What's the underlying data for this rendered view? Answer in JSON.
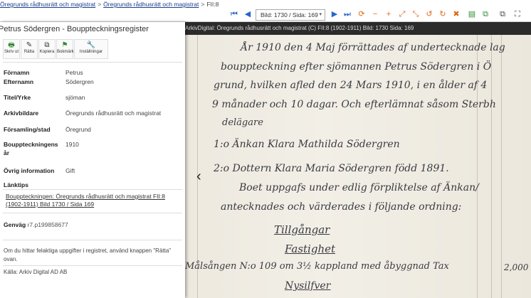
{
  "breadcrumb": {
    "items": [
      "Öregrunds rådhusrätt och magistrat",
      "Öregrunds rådhusrätt och magistrat",
      "FII:8"
    ],
    "separator": ">"
  },
  "toolbar": {
    "page_select": "Bild: 1730 / Sida: 169",
    "caret": "▾"
  },
  "icons": {
    "first": "⏮",
    "prev": "◀",
    "next": "▶",
    "last": "⏭",
    "refresh": "⟳",
    "zoom_out": "−",
    "zoom_in": "+",
    "fit": "⤢",
    "fit_width": "⤡",
    "rotate_left": "↺",
    "rotate_right": "↻",
    "close": "✖",
    "print": "▤",
    "copy": "⧉",
    "expand": "⛶"
  },
  "panel": {
    "title": "Petrus Södergren - Bouppteckningsregister",
    "actions": [
      {
        "icon": "🖶",
        "label": "Skriv ut"
      },
      {
        "icon": "✎",
        "label": "Rätta"
      },
      {
        "icon": "⧉",
        "label": "Kopiera"
      },
      {
        "icon": "⚑",
        "label": "Bokmärk"
      },
      {
        "icon": "🔧",
        "label": "Inställningar"
      }
    ],
    "fields": [
      {
        "label": "Förnamn",
        "value": "Petrus"
      },
      {
        "label": "Efternamn",
        "value": "Södergren"
      },
      {
        "label": "Titel/Yrke",
        "value": "sjöman"
      },
      {
        "label": "Arkivbildare",
        "value": "Öregrunds rådhusrätt och magistrat"
      },
      {
        "label": "Församling/stad",
        "value": "Öregrund"
      },
      {
        "label": "Bouppteckningens år",
        "value": "1910"
      },
      {
        "label": "Övrig information",
        "value": "Gift"
      }
    ],
    "links_heading": "Länktips",
    "link_text": "Bouppteckningen: Öregrunds rådhusrätt och magistrat FII:8 (1902-1911) Bild 1730 / Sida 169",
    "shortcut_label": "Genväg",
    "shortcut_value": "r7.p199858677",
    "note": "Om du hittar felaktiga uppgifter i registret, använd knappen \"Rätta\" ovan.",
    "source": "Källa: Arkiv Digital AD AB"
  },
  "viewer": {
    "caption": "ArkivDigital: Öregrunds rådhusrätt och magistrat (C) FII:8 (1902-1911) Bild: 1730 Sida: 169",
    "prev_arrow": "‹",
    "handwriting": [
      "År 1910 den 4 Maj förrättades af undertecknade lag",
      "bouppteckning efter sjömannen Petrus Södergren i Ö",
      "grund, hvilken afled den 24 Mars 1910, i en ålder af 4",
      "9 månader och 10 dagar. Och efterlämnat såsom Sterbh",
      "delägare",
      "1:o Änkan Klara Mathilda Södergren",
      "2:o Dottern Klara Maria Södergren född 1891.",
      "Boet uppgafs under edlig förpliktelse af Änkan/",
      "antecknades och värderades i följande ordning:",
      "Tillgångar",
      "Fastighet",
      "Målsången N:o 109 om 3½ kappland med åbyggnad Tax",
      "2,000",
      "Nysilfver"
    ]
  }
}
